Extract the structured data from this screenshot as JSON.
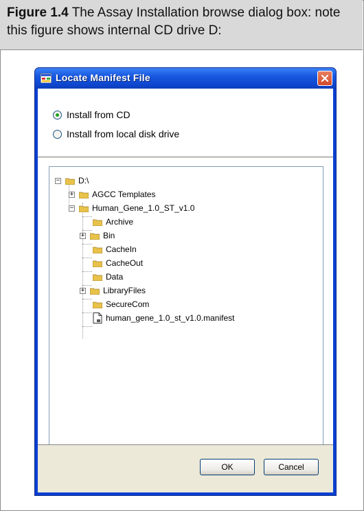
{
  "caption": {
    "figure_label": "Figure 1.4",
    "text": "The Assay Installation browse dialog box: note this figure shows internal CD drive D:"
  },
  "dialog": {
    "title": "Locate Manifest File",
    "options": [
      {
        "label": "Install from CD",
        "selected": true
      },
      {
        "label": "Install from local disk drive",
        "selected": false
      }
    ],
    "tree": {
      "root": "D:\\",
      "items": [
        {
          "label": "AGCC Templates",
          "type": "folder",
          "expander": "plus"
        },
        {
          "label": "Human_Gene_1.0_ST_v1.0",
          "type": "folder",
          "expander": "minus"
        },
        {
          "label": "Archive",
          "type": "folder",
          "expander": "none"
        },
        {
          "label": "Bin",
          "type": "folder",
          "expander": "plus"
        },
        {
          "label": "CacheIn",
          "type": "folder",
          "expander": "none"
        },
        {
          "label": "CacheOut",
          "type": "folder",
          "expander": "none"
        },
        {
          "label": "Data",
          "type": "folder",
          "expander": "none"
        },
        {
          "label": "LibraryFiles",
          "type": "folder",
          "expander": "plus"
        },
        {
          "label": "SecureCom",
          "type": "folder",
          "expander": "none"
        },
        {
          "label": "human_gene_1.0_st_v1.0.manifest",
          "type": "file",
          "expander": "none"
        }
      ]
    },
    "buttons": {
      "ok": "OK",
      "cancel": "Cancel"
    }
  },
  "colors": {
    "titlebar": "#0f47cf",
    "caption_bg": "#d9d9d9",
    "folder": "#e8c24a",
    "radio_dot": "#21a121"
  }
}
